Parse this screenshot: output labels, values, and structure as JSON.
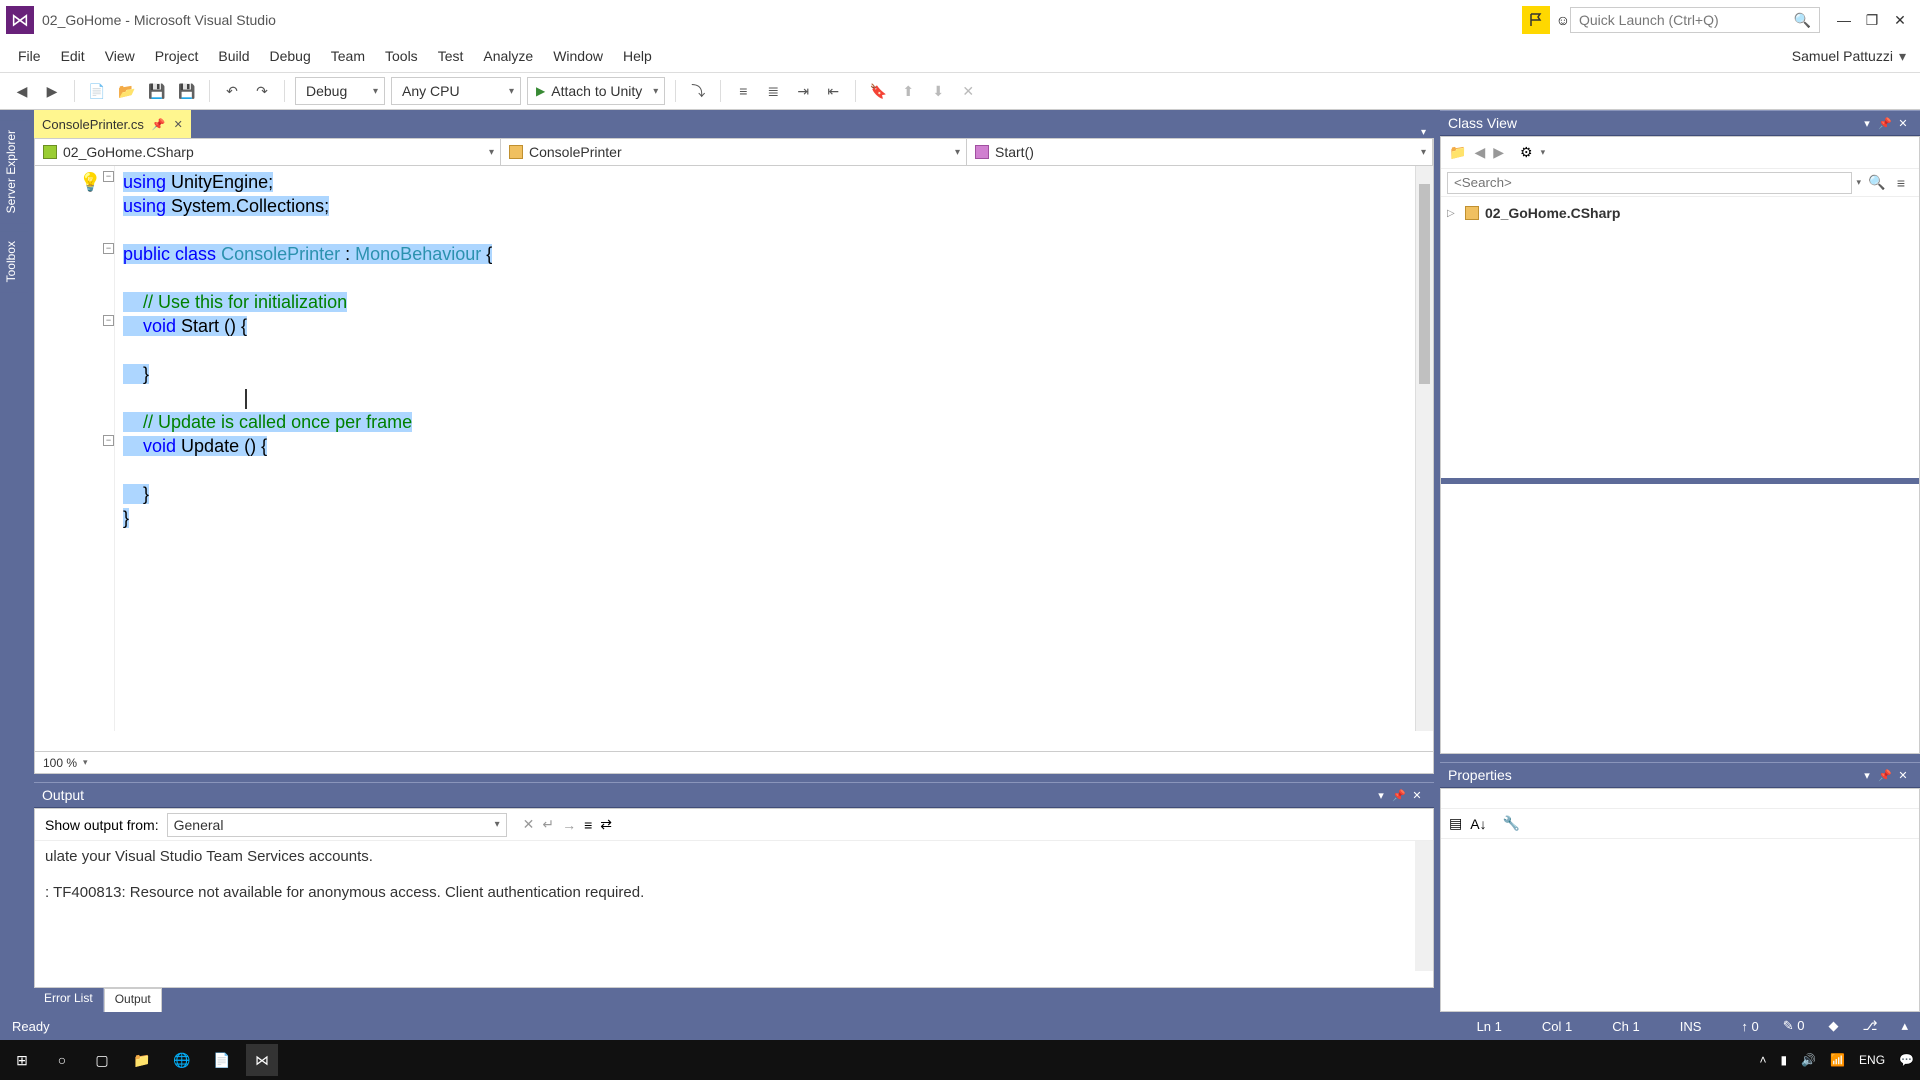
{
  "title": "02_GoHome - Microsoft Visual Studio",
  "quick_launch_placeholder": "Quick Launch (Ctrl+Q)",
  "menu": [
    "File",
    "Edit",
    "View",
    "Project",
    "Build",
    "Debug",
    "Team",
    "Tools",
    "Test",
    "Analyze",
    "Window",
    "Help"
  ],
  "user": "Samuel Pattuzzi",
  "toolbar": {
    "config": "Debug",
    "platform": "Any CPU",
    "start": "Attach to Unity"
  },
  "doc_tab": {
    "name": "ConsolePrinter.cs"
  },
  "nav": {
    "project": "02_GoHome.CSharp",
    "class": "ConsolePrinter",
    "member": "Start()"
  },
  "code": {
    "l1a": "using",
    "l1b": " UnityEngine;",
    "l2a": "using",
    "l2b": " System.Collections;",
    "l4a": "public",
    "l4b": "class",
    "l4c": "ConsolePrinter",
    "l4d": " : ",
    "l4e": "MonoBehaviour",
    "l4f": " {",
    "l6": "    // Use this for initialization",
    "l7a": "    ",
    "l7b": "void",
    "l7c": " Start () {",
    "l9": "    }",
    "l11": "    // Update is called once per frame",
    "l12a": "    ",
    "l12b": "void",
    "l12c": " Update () {",
    "l14": "    }",
    "l15": "}"
  },
  "zoom": "100 %",
  "output": {
    "title": "Output",
    "show_from_label": "Show output from:",
    "source": "General",
    "text1": "ulate your Visual Studio Team Services accounts.",
    "text2": ": TF400813: Resource not available for anonymous access. Client authentication required."
  },
  "bottom_tabs": {
    "error_list": "Error List",
    "output": "Output"
  },
  "class_view": {
    "title": "Class View",
    "search_placeholder": "<Search>",
    "root": "02_GoHome.CSharp"
  },
  "properties": {
    "title": "Properties"
  },
  "status": {
    "ready": "Ready",
    "ln": "Ln 1",
    "col": "Col 1",
    "ch": "Ch 1",
    "ins": "INS",
    "up": "0",
    "down": "0"
  },
  "tray": {
    "lang": "ENG"
  }
}
